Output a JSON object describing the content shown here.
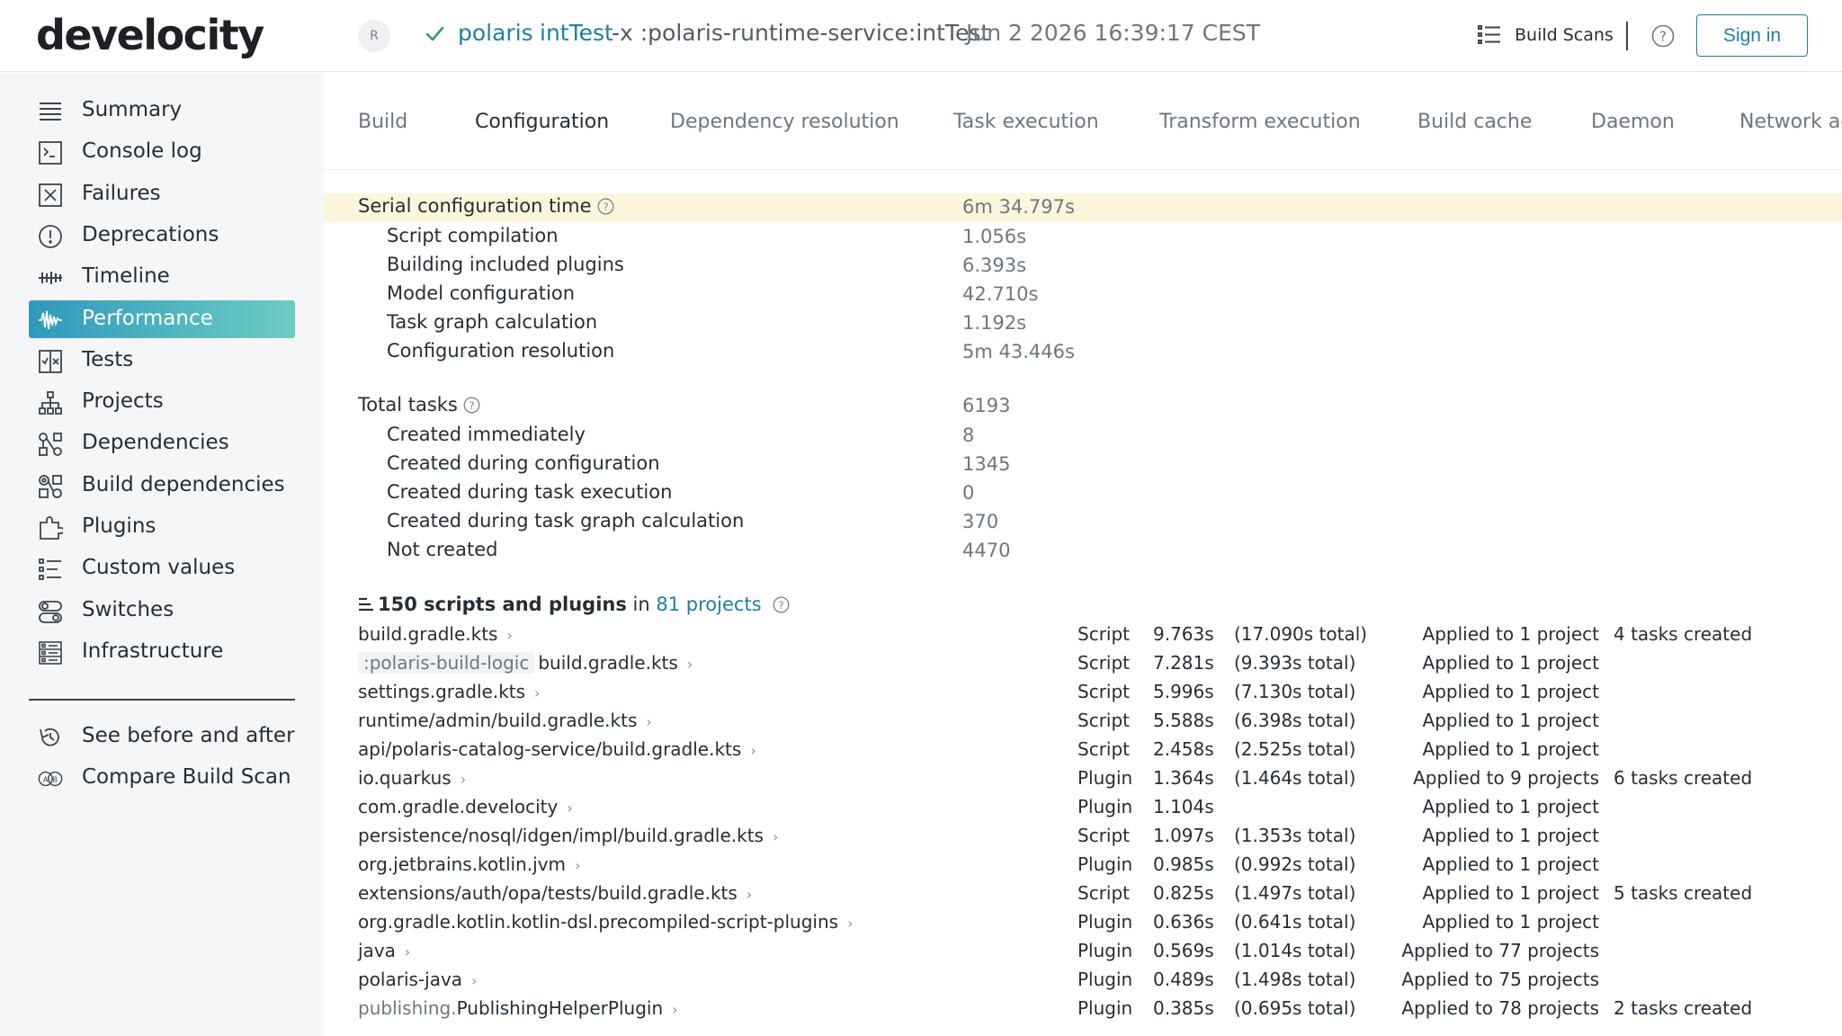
{
  "header": {
    "logo": "develocity",
    "avatar": "R",
    "project": "polaris",
    "task": "intTest",
    "args": "-x :polaris-runtime-service:intTest",
    "date": "Jun 2 2026 16:39:17 CEST",
    "build_scans_label": "Build Scans",
    "sign_in": "Sign in"
  },
  "sidebar": {
    "items": [
      {
        "label": "Summary",
        "icon": "summary-icon"
      },
      {
        "label": "Console log",
        "icon": "console-icon"
      },
      {
        "label": "Failures",
        "icon": "failures-icon"
      },
      {
        "label": "Deprecations",
        "icon": "deprecations-icon"
      },
      {
        "label": "Timeline",
        "icon": "timeline-icon"
      },
      {
        "label": "Performance",
        "icon": "performance-icon",
        "active": true
      },
      {
        "label": "Tests",
        "icon": "tests-icon"
      },
      {
        "label": "Projects",
        "icon": "projects-icon"
      },
      {
        "label": "Dependencies",
        "icon": "dependencies-icon"
      },
      {
        "label": "Build dependencies",
        "icon": "build-dependencies-icon"
      },
      {
        "label": "Plugins",
        "icon": "plugins-icon"
      },
      {
        "label": "Custom values",
        "icon": "custom-values-icon"
      },
      {
        "label": "Switches",
        "icon": "switches-icon"
      },
      {
        "label": "Infrastructure",
        "icon": "infrastructure-icon"
      }
    ],
    "bottom_items": [
      {
        "label": "See before and after",
        "icon": "history-icon"
      },
      {
        "label": "Compare Build Scan",
        "icon": "compare-icon"
      }
    ]
  },
  "tabs": [
    {
      "label": "Build"
    },
    {
      "label": "Configuration",
      "active": true
    },
    {
      "label": "Dependency resolution"
    },
    {
      "label": "Task execution"
    },
    {
      "label": "Transform execution"
    },
    {
      "label": "Build cache"
    },
    {
      "label": "Daemon"
    },
    {
      "label": "Network ac"
    }
  ],
  "config_time": {
    "label": "Serial configuration time",
    "value": "6m 34.797s",
    "items": [
      {
        "label": "Script compilation",
        "value": "1.056s"
      },
      {
        "label": "Building included plugins",
        "value": "6.393s"
      },
      {
        "label": "Model configuration",
        "value": "42.710s"
      },
      {
        "label": "Task graph calculation",
        "value": "1.192s"
      },
      {
        "label": "Configuration resolution",
        "value": "5m 43.446s"
      }
    ]
  },
  "total_tasks": {
    "label": "Total tasks",
    "value": "6193",
    "items": [
      {
        "label": "Created immediately",
        "value": "8"
      },
      {
        "label": "Created during configuration",
        "value": "1345"
      },
      {
        "label": "Created during task execution",
        "value": "0"
      },
      {
        "label": "Created during task graph calculation",
        "value": "370"
      },
      {
        "label": "Not created",
        "value": "4470"
      }
    ]
  },
  "scripts_header": {
    "count": "150 scripts and plugins",
    "in": "in",
    "projects": "81 projects"
  },
  "scripts": [
    {
      "prefix": "",
      "name": "build.gradle.kts",
      "type": "Script",
      "time": "9.763s",
      "total": "(17.090s total)",
      "applied": "Applied to 1 project",
      "tasks": "4 tasks created"
    },
    {
      "prefix": ":polaris-build-logic",
      "prefix_style": "chip",
      "name": "build.gradle.kts",
      "type": "Script",
      "time": "7.281s",
      "total": "(9.393s total)",
      "applied": "Applied to 1 project",
      "tasks": ""
    },
    {
      "prefix": "",
      "name": "settings.gradle.kts",
      "type": "Script",
      "time": "5.996s",
      "total": "(7.130s total)",
      "applied": "Applied to 1 project",
      "tasks": ""
    },
    {
      "prefix": "",
      "name": "runtime/admin/build.gradle.kts",
      "type": "Script",
      "time": "5.588s",
      "total": "(6.398s total)",
      "applied": "Applied to 1 project",
      "tasks": ""
    },
    {
      "prefix": "",
      "name": "api/polaris-catalog-service/build.gradle.kts",
      "type": "Script",
      "time": "2.458s",
      "total": "(2.525s total)",
      "applied": "Applied to 1 project",
      "tasks": ""
    },
    {
      "prefix": "",
      "name": "io.quarkus",
      "type": "Plugin",
      "time": "1.364s",
      "total": "(1.464s total)",
      "applied": "Applied to 9 projects",
      "tasks": "6 tasks created"
    },
    {
      "prefix": "",
      "name": "com.gradle.develocity",
      "type": "Plugin",
      "time": "1.104s",
      "total": "",
      "applied": "Applied to 1 project",
      "tasks": ""
    },
    {
      "prefix": "",
      "name": "persistence/nosql/idgen/impl/build.gradle.kts",
      "type": "Script",
      "time": "1.097s",
      "total": "(1.353s total)",
      "applied": "Applied to 1 project",
      "tasks": ""
    },
    {
      "prefix": "",
      "name": "org.jetbrains.kotlin.jvm",
      "type": "Plugin",
      "time": "0.985s",
      "total": "(0.992s total)",
      "applied": "Applied to 1 project",
      "tasks": ""
    },
    {
      "prefix": "",
      "name": "extensions/auth/opa/tests/build.gradle.kts",
      "type": "Script",
      "time": "0.825s",
      "total": "(1.497s total)",
      "applied": "Applied to 1 project",
      "tasks": "5 tasks created"
    },
    {
      "prefix": "",
      "name": "org.gradle.kotlin.kotlin-dsl.precompiled-script-plugins",
      "type": "Plugin",
      "time": "0.636s",
      "total": "(0.641s total)",
      "applied": "Applied to 1 project",
      "tasks": ""
    },
    {
      "prefix": "",
      "name": "java",
      "type": "Plugin",
      "time": "0.569s",
      "total": "(1.014s total)",
      "applied": "Applied to 77 projects",
      "tasks": ""
    },
    {
      "prefix": "",
      "name": "polaris-java",
      "type": "Plugin",
      "time": "0.489s",
      "total": "(1.498s total)",
      "applied": "Applied to 75 projects",
      "tasks": ""
    },
    {
      "prefix": "publishing.",
      "prefix_style": "plain",
      "name": "PublishingHelperPlugin",
      "type": "Plugin",
      "time": "0.385s",
      "total": "(0.695s total)",
      "applied": "Applied to 78 projects",
      "tasks": "2 tasks created"
    }
  ],
  "colors": {
    "accent": "#1d7fa5",
    "active_start": "#2f99bd",
    "active_end": "#6dcdc1",
    "highlight": "#fdf6dc",
    "check": "#2e9e6a"
  }
}
